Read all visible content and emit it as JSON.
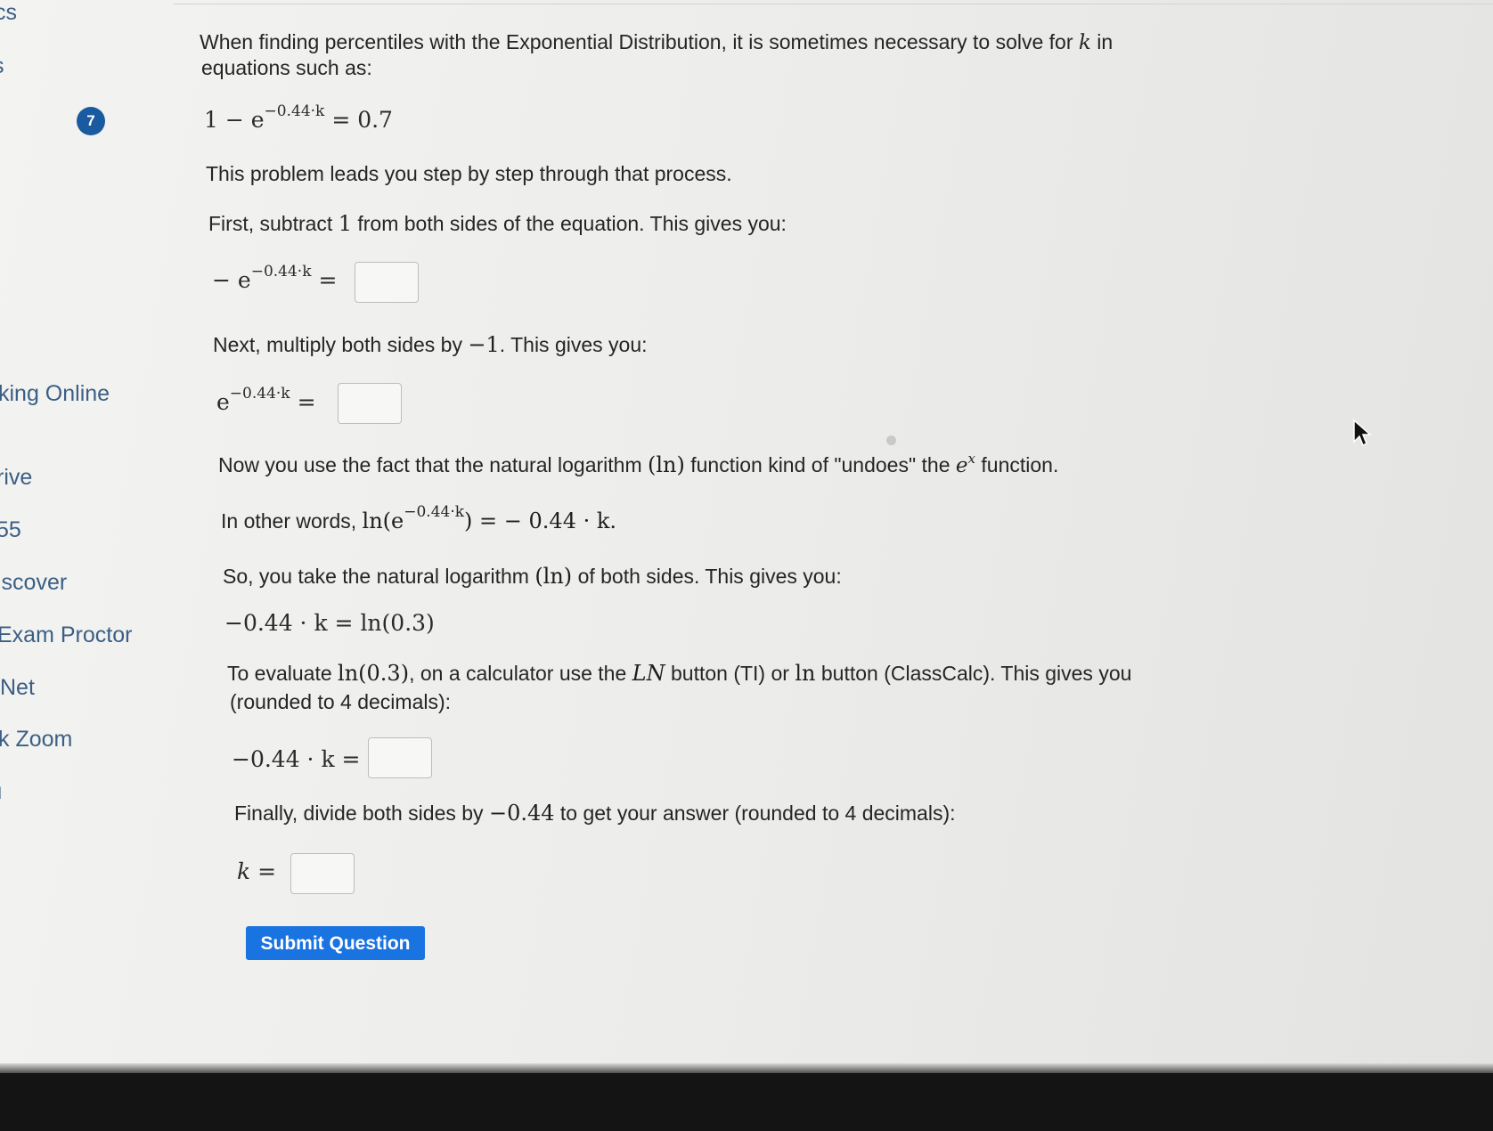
{
  "sidebar": {
    "items": [
      {
        "label": "cs"
      },
      {
        "label": "s"
      },
      {
        "label": "king Online"
      },
      {
        "label": "rive"
      },
      {
        "label": "55"
      },
      {
        "label": "iscover"
      },
      {
        "label": "Exam Proctor"
      },
      {
        "label": "Net"
      },
      {
        "label": "k Zoom"
      },
      {
        "label": "ı"
      }
    ]
  },
  "question": {
    "number": "7",
    "intro_line1_a": "When finding percentiles with the Exponential Distribution, it is sometimes necessary to solve for",
    "intro_var": "k",
    "intro_line1_b": "in",
    "intro_line2": "equations such as:",
    "main_eq": {
      "lhs": "1 − e",
      "exp": "−0.44·k",
      "rhs": "= 0.7"
    },
    "process_text": "This problem leads you step by step through that process.",
    "step1": {
      "a": "First, subtract",
      "num": "1",
      "b": "from both sides of the equation. This gives you:"
    },
    "step1_eq": {
      "lhs": "− e",
      "exp": "−0.44·k",
      "rhs": "="
    },
    "step2": {
      "a": "Next, multiply both sides by",
      "num": "−1",
      "b": ". This gives you:"
    },
    "step2_eq": {
      "lhs": "e",
      "exp": "−0.44·k",
      "rhs": "="
    },
    "step3": {
      "a": "Now you use the fact that the natural logarithm",
      "ln": "(ln)",
      "b": "function kind of \"undoes\" the",
      "e": "e",
      "ex": "x",
      "c": "function."
    },
    "other_words": {
      "a": "In other words,",
      "ln": "ln(e",
      "exp": "−0.44·k",
      "close": ")",
      "rhs": " =  − 0.44 · k."
    },
    "step4": {
      "a": "So, you take the natural logarithm",
      "ln": "(ln)",
      "b": "of both sides. This gives you:"
    },
    "step4_eq": "−0.44 · k = ln(0.3)",
    "step5": {
      "a": "To evaluate",
      "ln": "ln(0.3)",
      "b": ", on a calculator use the",
      "LN": "LN",
      "c": "button (TI) or",
      "ln2": "ln",
      "d": "button (ClassCalc). This gives you"
    },
    "step5_line2": "(rounded to 4 decimals):",
    "step5_eq": "−0.44 · k =",
    "step6": {
      "a": "Finally, divide both sides by",
      "num": "−0.44",
      "b": "to get your answer (rounded to 4 decimals):"
    },
    "step6_eq": "k =",
    "answers": {
      "box1": "",
      "box2": "",
      "box3": "",
      "box4": ""
    },
    "submit_label": "Submit Question"
  },
  "colors": {
    "accent": "#1973e0",
    "badge": "#1a5aa0",
    "sidebar_text": "#3b5f84"
  }
}
